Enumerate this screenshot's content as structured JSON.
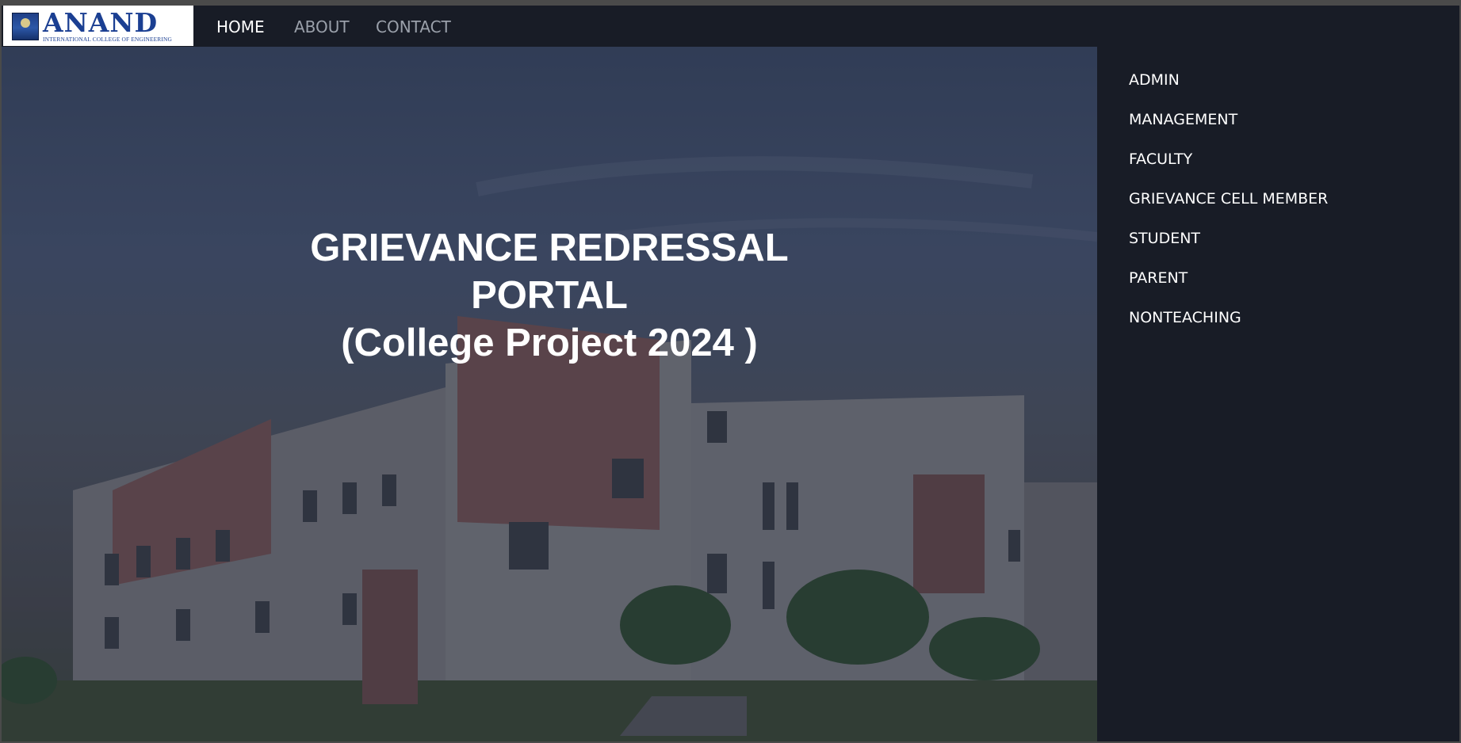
{
  "brand": {
    "name": "ANAND",
    "tagline": "INTERNATIONAL COLLEGE OF ENGINEERING"
  },
  "nav": {
    "items": [
      {
        "label": "HOME",
        "active": true
      },
      {
        "label": "ABOUT",
        "active": false
      },
      {
        "label": "CONTACT",
        "active": false
      }
    ]
  },
  "hero": {
    "line1": "GRIEVANCE REDRESSAL",
    "line2": "PORTAL",
    "line3": "(College Project 2024 )"
  },
  "sidebar": {
    "items": [
      {
        "label": "ADMIN"
      },
      {
        "label": "MANAGEMENT"
      },
      {
        "label": "FACULTY"
      },
      {
        "label": "GRIEVANCE CELL MEMBER"
      },
      {
        "label": "STUDENT"
      },
      {
        "label": "PARENT"
      },
      {
        "label": "NONTEACHING"
      }
    ]
  },
  "colors": {
    "background": "#181c26",
    "nav_active": "#ffffff",
    "nav_inactive": "#9aa0aa",
    "logo_blue": "#1b3f92"
  }
}
